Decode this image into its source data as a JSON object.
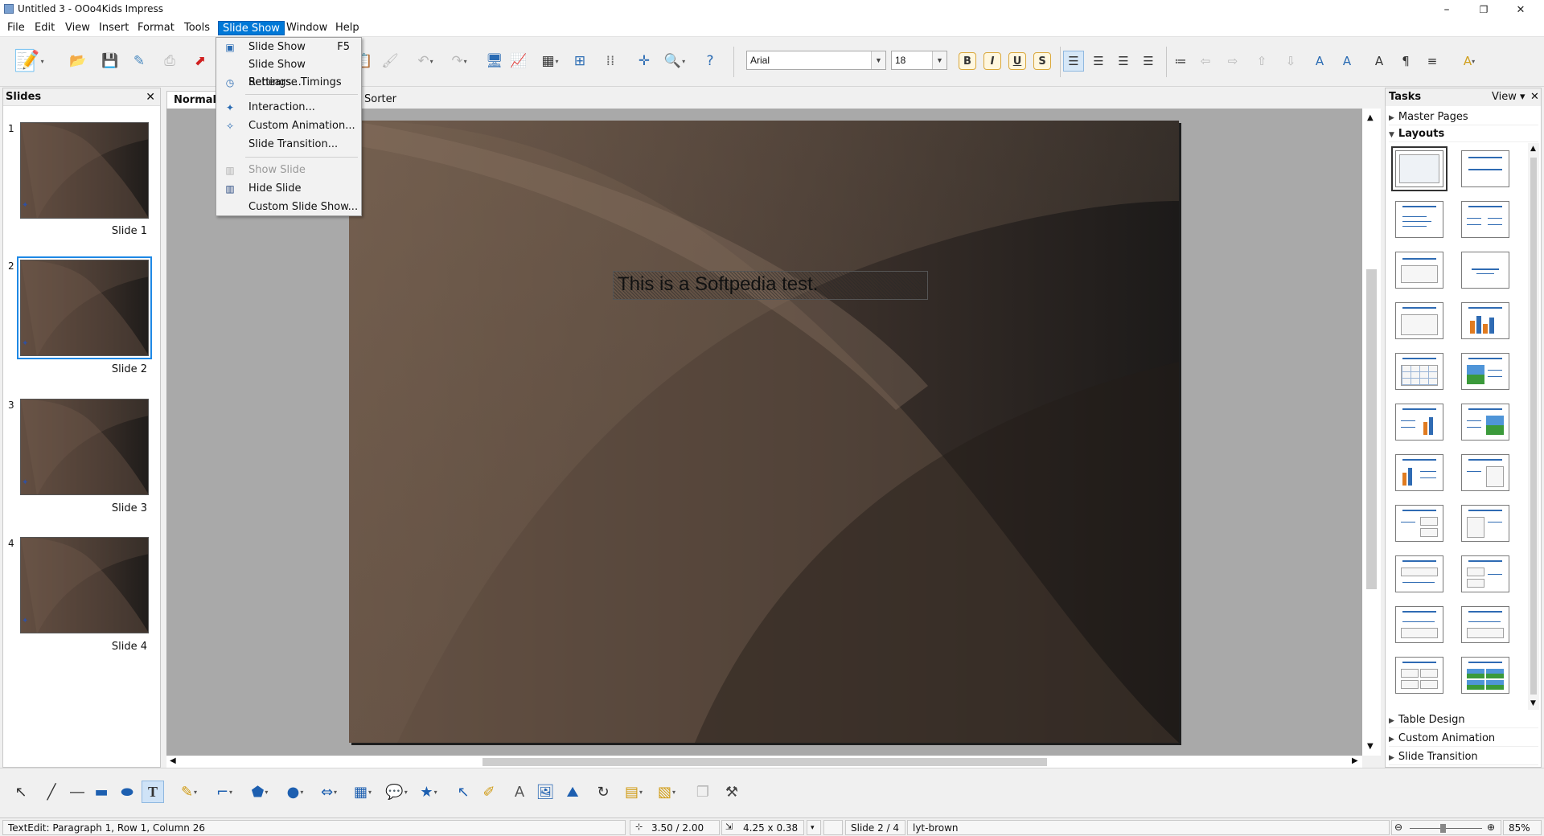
{
  "window": {
    "title": "Untitled 3 - OOo4Kids Impress",
    "minimize": "–",
    "maximize": "❐",
    "close": "✕"
  },
  "menubar": [
    "File",
    "Edit",
    "View",
    "Insert",
    "Format",
    "Tools",
    "Slide Show",
    "Window",
    "Help"
  ],
  "slideshow_menu": {
    "items": [
      {
        "label": "Slide Show",
        "accel": "F5",
        "icon": "slideshow-icon",
        "enabled": true
      },
      {
        "label": "Slide Show Settings...",
        "accel": "",
        "icon": "",
        "enabled": true
      },
      {
        "label": "Rehearse Timings",
        "accel": "",
        "icon": "rehearse-timings-icon",
        "enabled": true
      },
      {
        "label": "Interaction...",
        "accel": "",
        "icon": "interaction-icon",
        "enabled": true
      },
      {
        "label": "Custom Animation...",
        "accel": "",
        "icon": "custom-animation-icon",
        "enabled": true
      },
      {
        "label": "Slide Transition...",
        "accel": "",
        "icon": "",
        "enabled": true
      },
      {
        "label": "Show Slide",
        "accel": "",
        "icon": "show-slide-icon",
        "enabled": false
      },
      {
        "label": "Hide Slide",
        "accel": "",
        "icon": "hide-slide-icon",
        "enabled": true
      },
      {
        "label": "Custom Slide Show...",
        "accel": "",
        "icon": "",
        "enabled": true
      }
    ]
  },
  "toolbar": {
    "font_name": "Arial",
    "font_size": "18"
  },
  "slides_pane": {
    "title": "Slides",
    "close": "✕",
    "slides": [
      {
        "num": "1",
        "label": "Slide 1"
      },
      {
        "num": "2",
        "label": "Slide 2"
      },
      {
        "num": "3",
        "label": "Slide 3"
      },
      {
        "num": "4",
        "label": "Slide 4"
      }
    ],
    "selected": "2"
  },
  "view_tabs": [
    "Normal",
    "Sorter"
  ],
  "slide": {
    "text": "This is a Softpedia test."
  },
  "tasks_pane": {
    "title": "Tasks",
    "view_label": "View",
    "close": "✕",
    "sections": [
      "Master Pages",
      "Layouts",
      "Table Design",
      "Custom Animation",
      "Slide Transition"
    ]
  },
  "statusbar": {
    "textedit": "TextEdit: Paragraph 1, Row 1, Column 26",
    "position": "3.50 / 2.00",
    "size": "4.25 x 0.38",
    "slide": "Slide 2 / 4",
    "layout_name": "lyt-brown",
    "zoom": "85%"
  },
  "colors": {
    "accent": "#0078d7",
    "slide_dark": "#231f1c",
    "slide_light": "#6b5847"
  }
}
